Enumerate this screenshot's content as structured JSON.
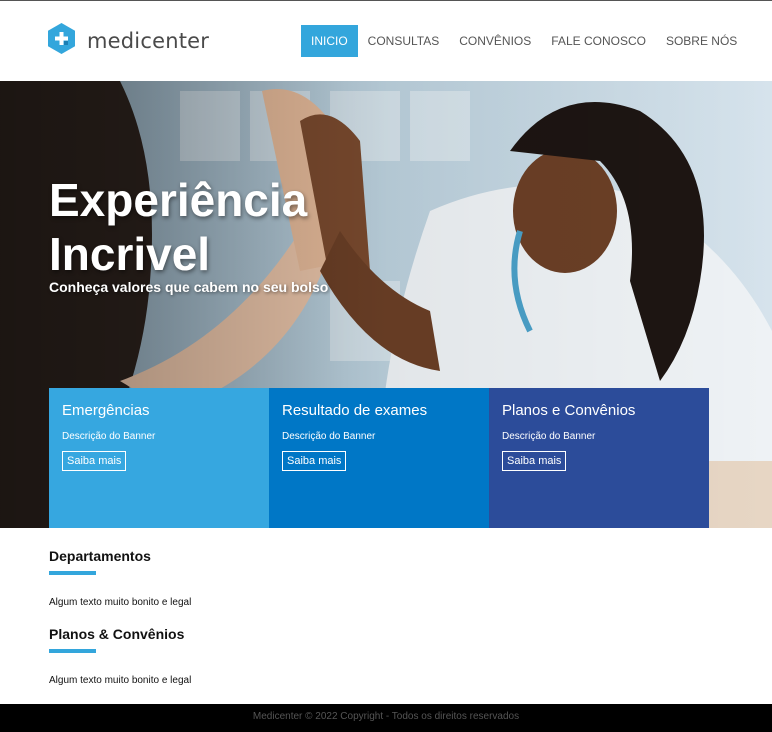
{
  "brand": {
    "name": "medicenter",
    "logo_icon": "hexagon-plus-icon",
    "color": "#33a6dc"
  },
  "nav": {
    "items": [
      {
        "label": "INICIO",
        "active": true
      },
      {
        "label": "CONSULTAS",
        "active": false
      },
      {
        "label": "CONVÊNIOS",
        "active": false
      },
      {
        "label": "FALE CONOSCO",
        "active": false
      },
      {
        "label": "SOBRE NÓS",
        "active": false
      }
    ]
  },
  "hero": {
    "title": "Experiência Incrivel",
    "subtitle": "Conheça valores que cabem no seu bolso"
  },
  "cards": [
    {
      "title": "Emergências",
      "description": "Descrição do Banner",
      "button": "Saiba mais",
      "color": "#36a7e0"
    },
    {
      "title": "Resultado de exames",
      "description": "Descrição do Banner",
      "button": "Saiba mais",
      "color": "#0077c6"
    },
    {
      "title": "Planos e Convênios",
      "description": "Descrição do Banner",
      "button": "Saiba mais",
      "color": "#2c4c9a"
    }
  ],
  "sections": [
    {
      "title": "Departamentos",
      "text": "Algum texto muito bonito e legal"
    },
    {
      "title": "Planos & Convênios",
      "text": "Algum texto muito bonito e legal"
    }
  ],
  "footer": {
    "text": "Medicenter © 2022 Copyright - Todos os direitos reservados"
  }
}
